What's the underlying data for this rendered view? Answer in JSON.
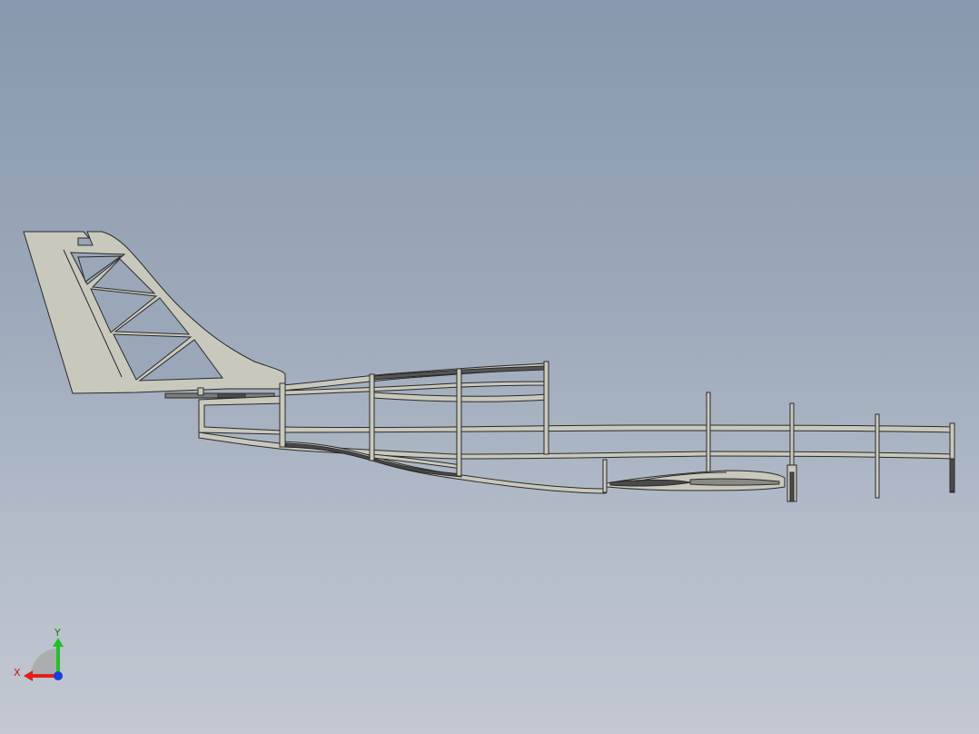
{
  "colors": {
    "background_top": "#8898ad",
    "background_bottom": "#c3c8d1",
    "part_fill": "#c9c8bd",
    "part_edge": "#2a2a2a",
    "dark_part": "#4a4a4a",
    "axis_x": "#e0201c",
    "axis_y": "#21c12a",
    "axis_z": "#1d3be0"
  },
  "triad": {
    "x_label": "X",
    "y_label": "Y"
  }
}
